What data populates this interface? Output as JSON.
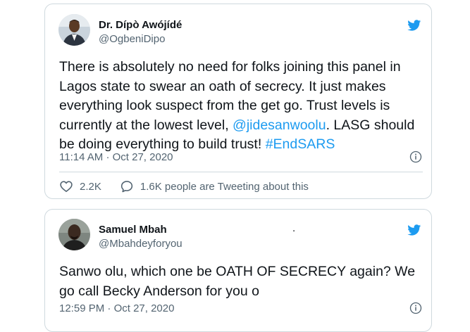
{
  "tweets": [
    {
      "author": {
        "name": "Dr. Dípò Awójídé",
        "handle": "@OgbeniDipo"
      },
      "text_parts": [
        "There is absolutely no need for folks joining this panel in Lagos state to swear an oath of secrecy. It just makes everything look suspect from the get go. Trust levels is currently at the lowest level, ",
        "@jidesanwoolu",
        ". LASG should be doing everything to build trust! ",
        "#EndSARS"
      ],
      "time": "11:14 AM",
      "separator": "·",
      "date": "Oct 27, 2020",
      "like_count": "2.2K",
      "reply_text": "1.6K people are Tweeting about this"
    },
    {
      "author": {
        "name": "Samuel Mbah",
        "handle": "@Mbahdeyforyou",
        "stray_mark": "."
      },
      "text": "Sanwo olu, which one be OATH OF SECRECY again? We go call Becky Anderson for you o",
      "time": "12:59 PM",
      "separator": "·",
      "date": "Oct 27, 2020"
    }
  ],
  "colors": {
    "twitter_blue": "#1d9bf0",
    "secondary_text": "#536471",
    "border": "#cfd9de"
  },
  "icons": [
    "twitter-bird-icon",
    "info-icon",
    "heart-icon",
    "speech-bubble-icon"
  ]
}
